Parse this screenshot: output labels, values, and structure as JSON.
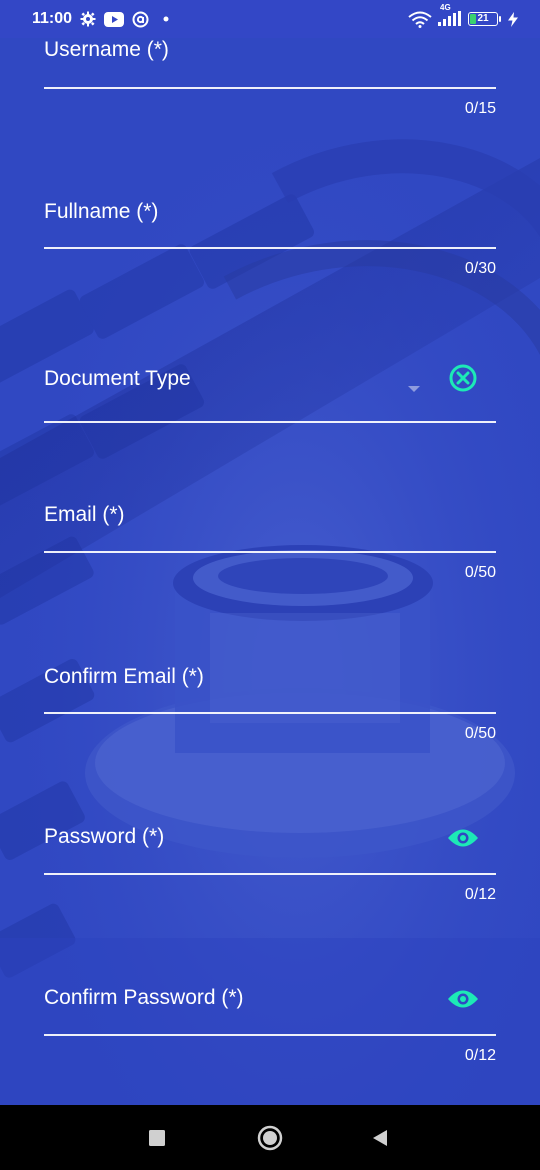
{
  "status_bar": {
    "time": "11:00",
    "icons": [
      "gear-icon",
      "youtube-icon",
      "at-sign-icon",
      "dot-icon"
    ],
    "network_label": "4G",
    "battery_level": "21",
    "right_icons": [
      "wifi-icon",
      "signal-icon",
      "battery-icon",
      "charging-icon"
    ]
  },
  "form": {
    "username": {
      "label": "Username (*)",
      "counter": "0/15"
    },
    "fullname": {
      "label": "Fullname (*)",
      "counter": "0/30"
    },
    "document_type": {
      "label": "Document Type",
      "clear_icon": "clear-circle-icon"
    },
    "email": {
      "label": "Email (*)",
      "counter": "0/50"
    },
    "confirm_email": {
      "label": "Confirm Email (*)",
      "counter": "0/50"
    },
    "password": {
      "label": "Password (*)",
      "counter": "0/12",
      "toggle_icon": "eye-icon"
    },
    "confirm_password": {
      "label": "Confirm Password (*)",
      "counter": "0/12",
      "toggle_icon": "eye-icon"
    }
  },
  "nav_bar": {
    "buttons": [
      "recent-apps-icon",
      "home-icon",
      "back-icon"
    ]
  },
  "colors": {
    "background_blue": "#3048c2",
    "accent_green": "#1de9b6",
    "text": "#ffffff"
  }
}
